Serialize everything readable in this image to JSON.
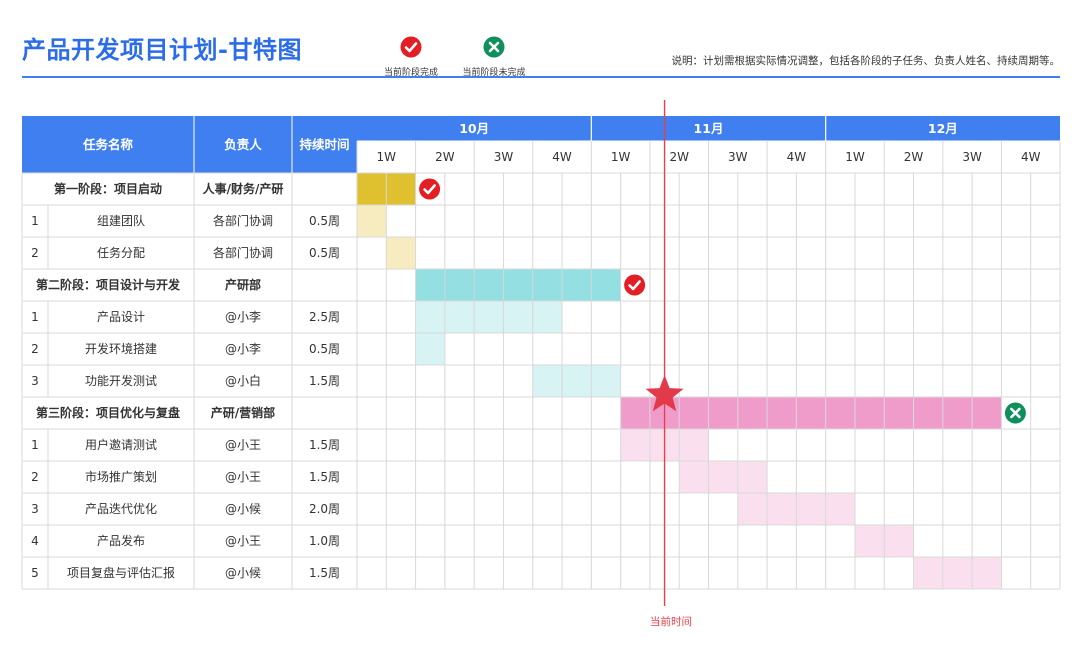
{
  "title": "产品开发项目计划-甘特图",
  "legend": {
    "done": {
      "label": "当前阶段完成",
      "icon": "check-circle-icon",
      "color": "#e31e24"
    },
    "undone": {
      "label": "当前阶段未完成",
      "icon": "x-circle-icon",
      "color": "#0e8f5c"
    }
  },
  "note": "说明：计划需根据实际情况调整，包括各阶段的子任务、负责人姓名、持续周期等。",
  "now_label": "当前时间",
  "table": {
    "headers": {
      "task": "任务名称",
      "owner": "负责人",
      "duration": "持续时间"
    },
    "months": [
      "10月",
      "11月",
      "12月"
    ],
    "weeks": [
      "1W",
      "2W",
      "3W",
      "4W"
    ],
    "rows": [
      {
        "kind": "phase",
        "task": "第一阶段：项目启动",
        "owner": "人事/财务/产研",
        "duration": ""
      },
      {
        "kind": "task",
        "num": "1",
        "task": "组建团队",
        "owner": "各部门协调",
        "duration": "0.5周"
      },
      {
        "kind": "task",
        "num": "2",
        "task": "任务分配",
        "owner": "各部门协调",
        "duration": "0.5周"
      },
      {
        "kind": "phase",
        "task": "第二阶段：项目设计与开发",
        "owner": "产研部",
        "duration": ""
      },
      {
        "kind": "task",
        "num": "1",
        "task": "产品设计",
        "owner": "@小李",
        "duration": "2.5周"
      },
      {
        "kind": "task",
        "num": "2",
        "task": "开发环境搭建",
        "owner": "@小李",
        "duration": "0.5周"
      },
      {
        "kind": "task",
        "num": "3",
        "task": "功能开发测试",
        "owner": "@小白",
        "duration": "1.5周"
      },
      {
        "kind": "phase",
        "task": "第三阶段：项目优化与复盘",
        "owner": "产研/营销部",
        "duration": ""
      },
      {
        "kind": "task",
        "num": "1",
        "task": "用户邀请测试",
        "owner": "@小王",
        "duration": "1.5周"
      },
      {
        "kind": "task",
        "num": "2",
        "task": "市场推广策划",
        "owner": "@小王",
        "duration": "1.5周"
      },
      {
        "kind": "task",
        "num": "3",
        "task": "产品迭代优化",
        "owner": "@小候",
        "duration": "2.0周"
      },
      {
        "kind": "task",
        "num": "4",
        "task": "产品发布",
        "owner": "@小王",
        "duration": "1.0周"
      },
      {
        "kind": "task",
        "num": "5",
        "task": "项目复盘与评估汇报",
        "owner": "@小候",
        "duration": "1.5周"
      }
    ]
  },
  "chart_data": {
    "type": "gantt",
    "time_unit": "half-week",
    "time_axis": [
      "10月 1W",
      "10月 2W",
      "10月 3W",
      "10月 4W",
      "11月 1W",
      "11月 2W",
      "11月 3W",
      "11月 4W",
      "12月 1W",
      "12月 2W",
      "12月 3W",
      "12月 4W"
    ],
    "current_time": 10.5,
    "bars": [
      {
        "row": 0,
        "start": 0,
        "end": 2,
        "color": "#dfc02e",
        "status": "done"
      },
      {
        "row": 1,
        "start": 0,
        "end": 1,
        "color": "#f7ecc0"
      },
      {
        "row": 2,
        "start": 1,
        "end": 2,
        "color": "#f7ecc0"
      },
      {
        "row": 3,
        "start": 2,
        "end": 9,
        "color": "#93dfe2",
        "status": "done"
      },
      {
        "row": 4,
        "start": 2,
        "end": 7,
        "color": "#d8f3f4"
      },
      {
        "row": 5,
        "start": 2,
        "end": 3,
        "color": "#d8f3f4"
      },
      {
        "row": 6,
        "start": 6,
        "end": 9,
        "color": "#d8f3f4"
      },
      {
        "row": 7,
        "start": 9,
        "end": 22,
        "color": "#f09ccb",
        "status": "undone"
      },
      {
        "row": 8,
        "start": 9,
        "end": 12,
        "color": "#fae0ee"
      },
      {
        "row": 9,
        "start": 11,
        "end": 14,
        "color": "#fae0ee"
      },
      {
        "row": 10,
        "start": 13,
        "end": 17,
        "color": "#fae0ee"
      },
      {
        "row": 11,
        "start": 17,
        "end": 19,
        "color": "#fae0ee"
      },
      {
        "row": 12,
        "start": 19,
        "end": 22,
        "color": "#fae0ee"
      }
    ]
  },
  "colors": {
    "accent": "#3f7ff0",
    "now_line": "#e8404a",
    "star": "#e23a4a"
  }
}
